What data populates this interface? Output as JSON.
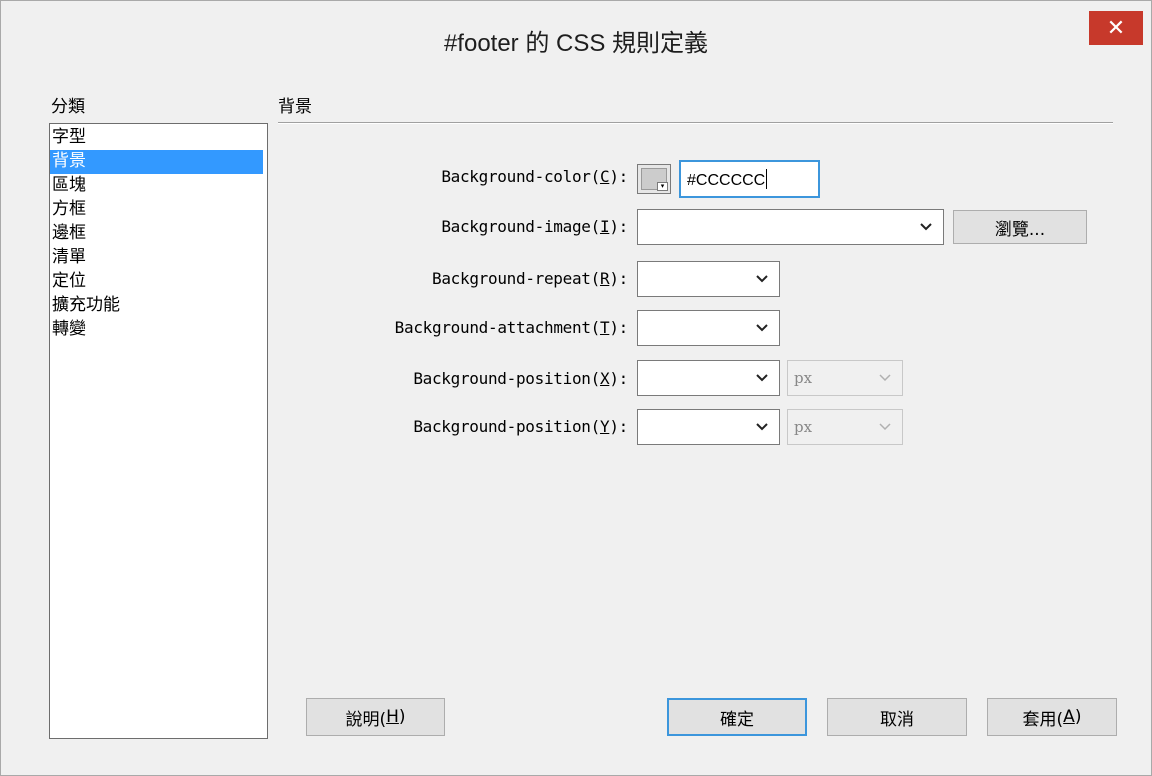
{
  "window": {
    "title": "#footer 的 CSS 規則定義",
    "close_glyph": "✕"
  },
  "category": {
    "label": "分類",
    "items": [
      "字型",
      "背景",
      "區塊",
      "方框",
      "邊框",
      "清單",
      "定位",
      "擴充功能",
      "轉變"
    ],
    "selected_index": 1
  },
  "section": {
    "title": "背景"
  },
  "fields": {
    "bg_color": {
      "label_pre": "Background-color(",
      "accel": "C",
      "label_post": "):",
      "value": "#CCCCCC",
      "swatch_color": "#cccccc"
    },
    "bg_image": {
      "label_pre": "Background-image(",
      "accel": "I",
      "label_post": "):",
      "value": "",
      "browse_label": "瀏覽..."
    },
    "bg_repeat": {
      "label_pre": "Background-repeat(",
      "accel": "R",
      "label_post": "):",
      "value": ""
    },
    "bg_attachment": {
      "label_pre": "Background-attachment(",
      "accel": "T",
      "label_post": "):",
      "value": ""
    },
    "bg_pos_x": {
      "label_pre": "Background-position(",
      "accel": "X",
      "label_post": "):",
      "value": "",
      "unit": "px"
    },
    "bg_pos_y": {
      "label_pre": "Background-position(",
      "accel": "Y",
      "label_post": "):",
      "value": "",
      "unit": "px"
    }
  },
  "buttons": {
    "help": {
      "pre": "說明(",
      "accel": "H",
      "post": ")"
    },
    "ok": {
      "label": "確定"
    },
    "cancel": {
      "label": "取消"
    },
    "apply": {
      "pre": "套用(",
      "accel": "A",
      "post": ")"
    }
  },
  "colors": {
    "selection": "#3399ff",
    "close_button": "#c7392b",
    "focus_border": "#3c96dc"
  }
}
